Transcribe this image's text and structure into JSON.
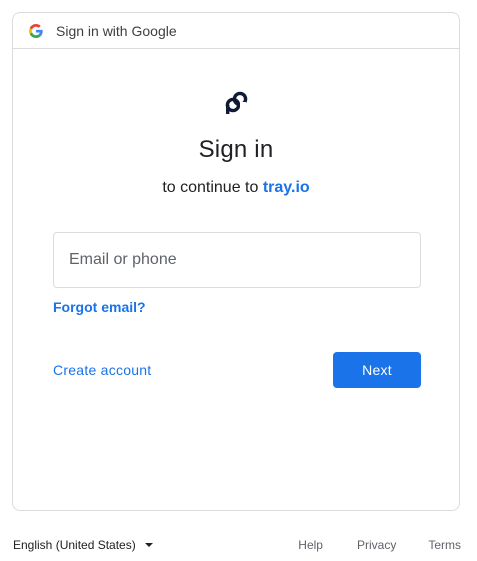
{
  "header": {
    "icon": "google-g-icon",
    "title": "Sign in with Google"
  },
  "logo": {
    "icon": "tray-io-logo-icon"
  },
  "main": {
    "title": "Sign in",
    "subtitle_prefix": "to continue to",
    "app_name": "tray.io",
    "email_input": {
      "placeholder": "Email or phone",
      "value": ""
    },
    "forgot_email_label": "Forgot email?",
    "create_account_label": "Create account",
    "next_label": "Next"
  },
  "footer": {
    "language": "English (United States)",
    "links": {
      "help": "Help",
      "privacy": "Privacy",
      "terms": "Terms"
    }
  },
  "colors": {
    "accent": "#1a73e8",
    "border": "#dadce0",
    "text": "#202124",
    "muted": "#5f6368"
  }
}
